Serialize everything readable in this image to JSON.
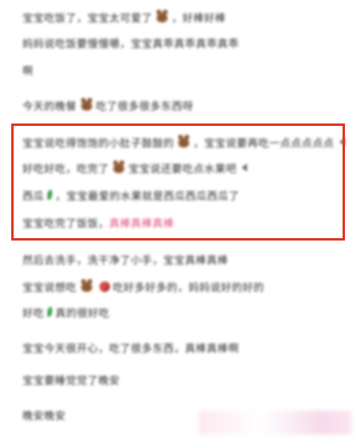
{
  "lines": [
    {
      "text_a": "宝宝吃饭了，宝宝太可爱了",
      "text_b": "，好棒好棒"
    },
    {
      "text_a": "妈妈说吃饭要慢慢嚼，宝宝真乖真乖真乖真乖"
    },
    {
      "text_a": "啊"
    },
    {
      "text_a": "今天的晚餐",
      "text_b": "吃了很多很多东西呀"
    },
    {
      "text_a": "宝宝说吃得饱饱的小肚子鼓鼓的",
      "text_b": "，宝宝说要再吃一点点点点点"
    },
    {
      "text_a": "好吃好吃，吃完了",
      "text_b": "宝宝说还要吃点水果吧"
    },
    {
      "text_a": "西瓜",
      "text_b": "，宝宝最爱的水果就是西瓜西瓜西瓜了"
    },
    {
      "text_a": "宝宝吃完了饭饭，",
      "text_pink": "真棒真棒真棒"
    },
    {
      "text_a": "然后去洗手，洗干净了小手，宝宝真棒真棒"
    },
    {
      "text_a": "宝宝说想吃",
      "text_b": "吃好多好多的，妈妈说好的好的"
    },
    {
      "text_a": "好吃",
      "text_b": "真的很好吃"
    },
    {
      "text_a": "宝宝今天很开心，吃了很多东西，真棒真棒啊"
    },
    {
      "text_a": "宝宝要睡觉觉了晚安"
    },
    {
      "text_a": "晚安晚安"
    }
  ],
  "colors": {
    "highlight_border": "#e0341f",
    "pink_text": "#e24a78",
    "text": "#2b2b2b"
  }
}
